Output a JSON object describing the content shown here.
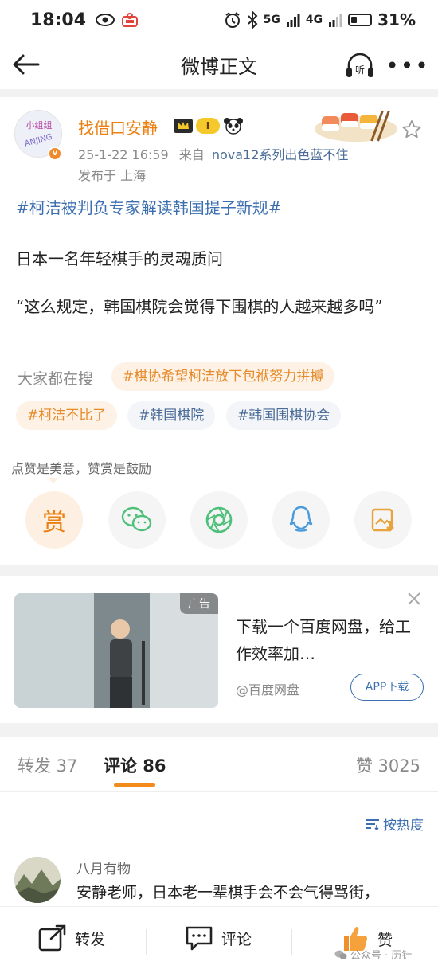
{
  "status_bar": {
    "time": "18:04",
    "network_5g": "5G",
    "network_4g": "4G",
    "battery_percent": "31%",
    "battery_level": 0.31
  },
  "nav": {
    "title": "微博正文",
    "listen_label": "听"
  },
  "post": {
    "avatar_text": "小组组 ANJING",
    "username": "找借口安静",
    "vip_level": "I",
    "date": "25-1-22 16:59",
    "source_prefix": "来自",
    "source": "nova12系列出色蓝不住",
    "location": "发布于 上海",
    "topic": "#柯洁被判负专家解读韩国提子新规#",
    "paragraph1": "日本一名年轻棋手的灵魂质问",
    "paragraph2": "“这么规定，韩国棋院会觉得下围棋的人越来越多吗”"
  },
  "search_section": {
    "label": "大家都在搜",
    "chips": [
      "#棋协希望柯洁放下包袱努力拼搏",
      "#柯洁不比了",
      "#韩国棋院",
      "#韩国围棋协会"
    ]
  },
  "reward": {
    "tip": "点赞是美意，赞赏是鼓励",
    "reward_label": "赏"
  },
  "ad": {
    "label": "广告",
    "title": "下载一个百度网盘，给工作效率加…",
    "source": "@百度网盘",
    "cta": "APP下载"
  },
  "tabs": {
    "repost": "转发 37",
    "comment": "评论 86",
    "like": "赞 3025"
  },
  "sort": {
    "label": "按热度"
  },
  "comment": {
    "user": "八月有物",
    "text": "安静老师，日本老一辈棋手会不会气得骂街，"
  },
  "bottom_bar": {
    "repost": "转发",
    "comment": "评论",
    "like": "赞"
  },
  "watermark": {
    "text": "公众号 · 历针"
  },
  "colors": {
    "accent_orange": "#ea8011",
    "link_blue": "#3b6fb0",
    "tab_underline": "#f28b1c"
  }
}
